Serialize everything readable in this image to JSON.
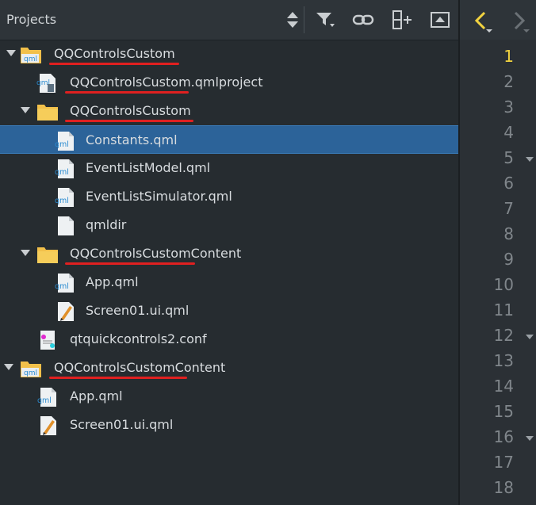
{
  "projects_pane": {
    "title": "Projects"
  },
  "tree": [
    {
      "label": "QQControlsCustom",
      "icon": "qml-folder-icon",
      "expanded": true,
      "underlined": true
    },
    {
      "label": "QQControlsCustom.qmlproject",
      "icon": "qmlproject-file-icon",
      "underlined": true
    },
    {
      "label": "QQControlsCustom",
      "icon": "folder-icon",
      "expanded": true,
      "underlined": true
    },
    {
      "label": "Constants.qml",
      "icon": "qml-file-icon",
      "selected": true
    },
    {
      "label": "EventListModel.qml",
      "icon": "qml-file-icon"
    },
    {
      "label": "EventListSimulator.qml",
      "icon": "qml-file-icon"
    },
    {
      "label": "qmldir",
      "icon": "blank-file-icon"
    },
    {
      "label": "QQControlsCustomContent",
      "icon": "folder-icon",
      "expanded": true,
      "underlined": true
    },
    {
      "label": "App.qml",
      "icon": "qml-file-icon"
    },
    {
      "label": "Screen01.ui.qml",
      "icon": "ui-qml-file-icon"
    },
    {
      "label": "qtquickcontrols2.conf",
      "icon": "conf-file-icon"
    },
    {
      "label": "QQControlsCustomContent",
      "icon": "qml-folder-icon",
      "expanded": true,
      "underlined": true
    },
    {
      "label": "App.qml",
      "icon": "qml-file-icon"
    },
    {
      "label": "Screen01.ui.qml",
      "icon": "ui-qml-file-icon"
    }
  ],
  "editor": {
    "line_numbers": [
      "1",
      "2",
      "3",
      "4",
      "5",
      "6",
      "7",
      "8",
      "9",
      "10",
      "11",
      "12",
      "13",
      "14",
      "15",
      "16",
      "17",
      "18"
    ],
    "current_line": "1",
    "fold_lines": [
      "5",
      "12",
      "16"
    ]
  },
  "colors": {
    "selection": "#2c6399",
    "underline_annotation": "#e02020",
    "current_line_number": "#f2d340"
  }
}
